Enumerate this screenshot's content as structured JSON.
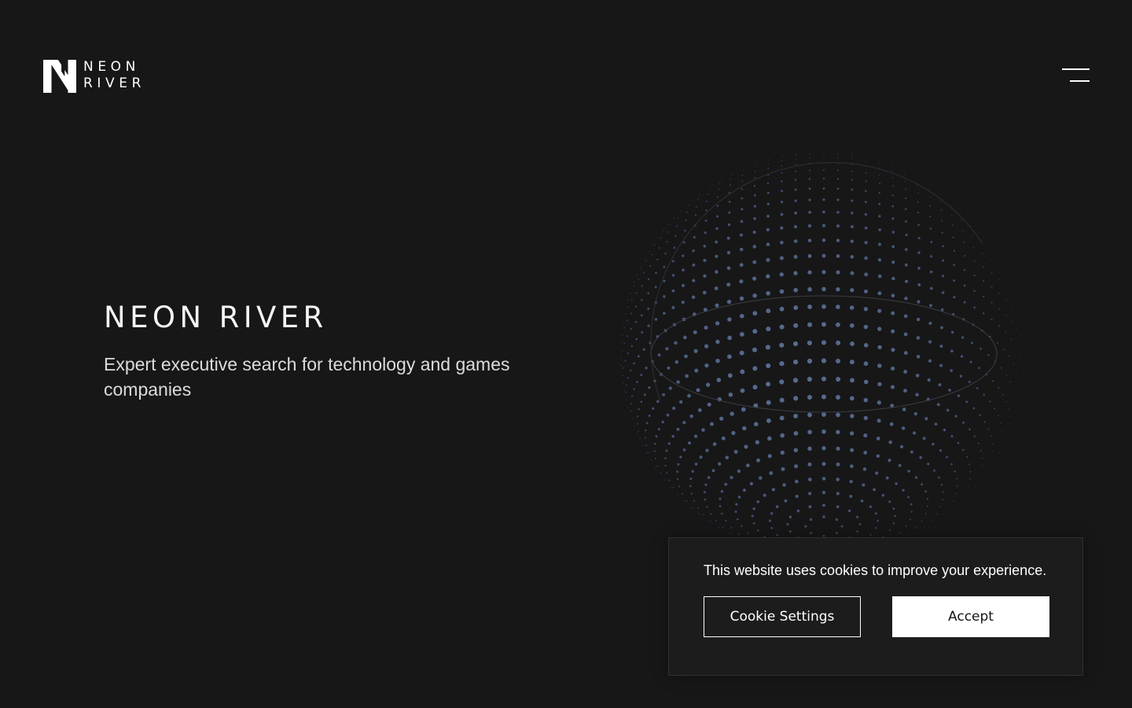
{
  "header": {
    "logo": {
      "line1": "NEON",
      "line2": "RIVER"
    },
    "menu_icon": "hamburger-menu-icon"
  },
  "hero": {
    "title": "NEON RIVER",
    "subtitle": "Expert executive search for technology and games companies",
    "graphic": "dotted-globe"
  },
  "cookie_banner": {
    "message": "This website uses cookies to improve your experience.",
    "settings_label": "Cookie Settings",
    "accept_label": "Accept"
  },
  "colors": {
    "background": "#171718",
    "text": "#ffffff",
    "globe_dot": "#5d6f85",
    "banner_background": "#1c1c1d"
  }
}
